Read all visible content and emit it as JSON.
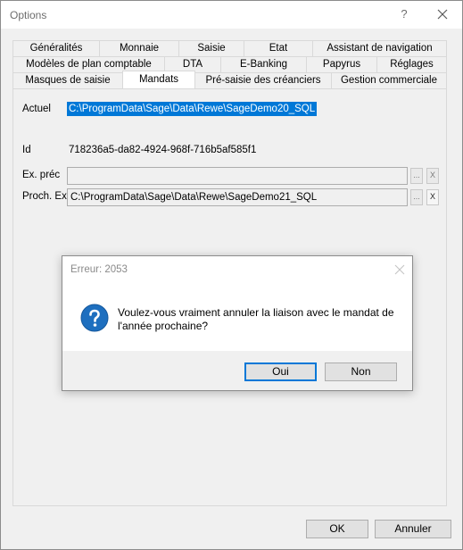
{
  "window": {
    "title": "Options",
    "help_label": "?"
  },
  "tabs": {
    "row1": [
      "Généralités",
      "Monnaie",
      "Saisie",
      "Etat",
      "Assistant de navigation"
    ],
    "row2": [
      "Modèles de plan comptable",
      "DTA",
      "E-Banking",
      "Papyrus",
      "Réglages"
    ],
    "row3": [
      "Masques de saisie",
      "Mandats",
      "Pré-saisie des créanciers",
      "Gestion commerciale"
    ],
    "selected": "Mandats"
  },
  "mandats": {
    "actuel_label": "Actuel",
    "actuel_value": "C:\\ProgramData\\Sage\\Data\\Rewe\\SageDemo20_SQL",
    "id_label": "Id",
    "id_value": "718236a5-da82-4924-968f-716b5af585f1",
    "ex_prec_label": "Ex. préc",
    "ex_prec_value": "",
    "proch_ex_label": "Proch. Ex",
    "proch_ex_value": "C:\\ProgramData\\Sage\\Data\\Rewe\\SageDemo21_SQL",
    "browse_label": "...",
    "clear_label": "X"
  },
  "dialog": {
    "title": "Erreur: 2053",
    "message": "Voulez-vous vraiment annuler la liaison avec le mandat de l'année prochaine?",
    "oui_label": "Oui",
    "non_label": "Non"
  },
  "footer": {
    "ok_label": "OK",
    "cancel_label": "Annuler"
  },
  "colors": {
    "accent": "#0078d7",
    "question_icon": "#1e6fbf"
  }
}
